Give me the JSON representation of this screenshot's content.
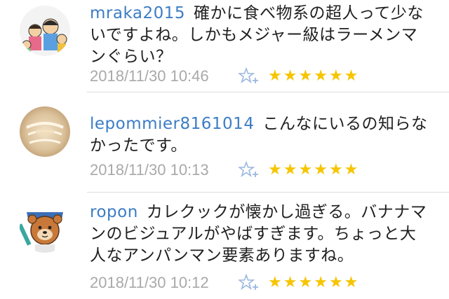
{
  "comments": [
    {
      "username": "mraka2015",
      "text": "確かに食べ物系の超人って少ないですよね。しかもメジャー級はラーメンマンぐらい？",
      "timestamp": "2018/11/30 10:46",
      "rating": 6,
      "avatar": "family-illustration"
    },
    {
      "username": "lepommier8161014",
      "text": "こんなにいるの知らなかったです。",
      "timestamp": "2018/11/30 10:13",
      "rating": 6,
      "avatar": "latte-art-photo"
    },
    {
      "username": "ropon",
      "text": "カレクックが懐かし過ぎる。バナナマンのビジュアルがやばすぎます。ちょっと大人なアンパンマン要素ありますね。",
      "timestamp": "2018/11/30 10:12",
      "rating": 6,
      "avatar": "bear-mascot"
    }
  ],
  "colors": {
    "username": "#3c7dc4",
    "timestamp": "#a9a9a9",
    "star": "#f6c500",
    "fav_icon": "#9bb7de",
    "divider": "#dcdcdc"
  },
  "icons": {
    "favorite": "star-plus-icon",
    "rating": "star-icon"
  }
}
